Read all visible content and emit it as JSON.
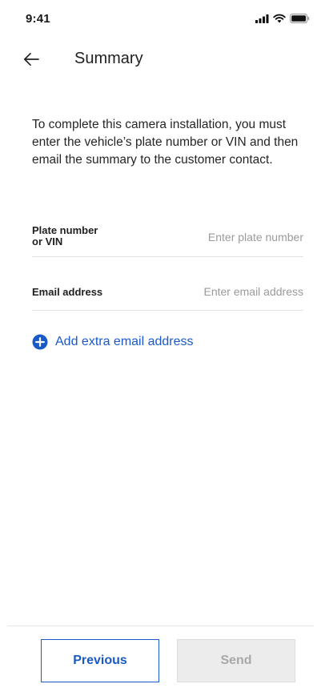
{
  "status_bar": {
    "time": "9:41"
  },
  "header": {
    "title": "Summary",
    "back_icon": "arrow-left-icon"
  },
  "description": "To complete this camera installation, you must enter the vehicle’s plate number or VIN and then email the summary to the customer contact.",
  "fields": {
    "plate": {
      "label_line1": "Plate number",
      "label_line2": "or VIN",
      "value": "",
      "placeholder": "Enter plate number"
    },
    "email": {
      "label": "Email address",
      "value": "",
      "placeholder": "Enter email address"
    }
  },
  "add_email": {
    "label": "Add extra email address",
    "icon": "plus-circle-icon"
  },
  "footer": {
    "previous_label": "Previous",
    "send_label": "Send",
    "send_enabled": false
  },
  "colors": {
    "accent": "#1a5ac8",
    "disabled_bg": "#ececec",
    "disabled_text": "#a8a8a8"
  }
}
